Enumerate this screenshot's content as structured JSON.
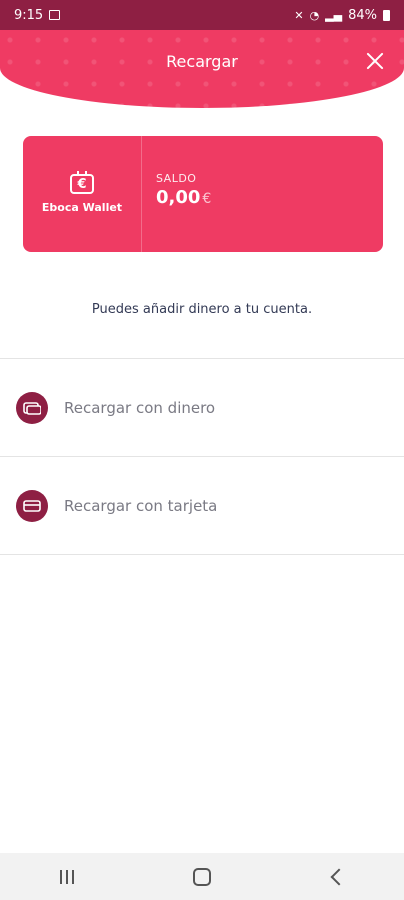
{
  "status_bar": {
    "time": "9:15",
    "battery": "84%"
  },
  "header": {
    "title": "Recargar"
  },
  "wallet": {
    "name": "Eboca Wallet",
    "icon_letter": "€",
    "balance_label": "SALDO",
    "balance_value": "0,00",
    "currency": "€"
  },
  "info_text": "Puedes añadir dinero a tu cuenta.",
  "options": [
    {
      "label": "Recargar con dinero",
      "icon": "cash-icon"
    },
    {
      "label": "Recargar con tarjeta",
      "icon": "credit-card-icon"
    }
  ],
  "colors": {
    "primary": "#ef3b63",
    "dark": "#8e1f43"
  }
}
